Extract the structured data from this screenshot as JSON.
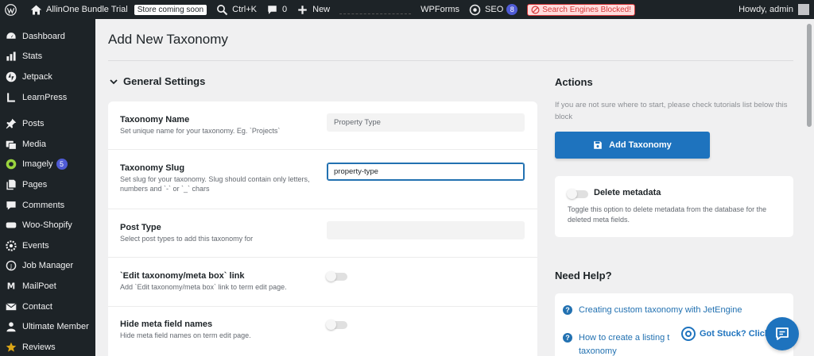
{
  "adminbar": {
    "site_name": "AllinOne Bundle Trial",
    "store_badge": "Store coming soon",
    "search_shortcut": "Ctrl+K",
    "comments_count": "0",
    "new_label": "New",
    "wpforms_label": "WPForms",
    "seo_label": "SEO",
    "seo_count": "8",
    "blocked_label": "Search Engines Blocked!",
    "howdy": "Howdy, admin"
  },
  "sidebar": {
    "items": [
      {
        "label": "Dashboard"
      },
      {
        "label": "Stats"
      },
      {
        "label": "Jetpack"
      },
      {
        "label": "LearnPress"
      },
      {
        "label": "Posts"
      },
      {
        "label": "Media"
      },
      {
        "label": "Imagely",
        "count": "5"
      },
      {
        "label": "Pages"
      },
      {
        "label": "Comments"
      },
      {
        "label": "Woo-Shopify"
      },
      {
        "label": "Events"
      },
      {
        "label": "Job Manager"
      },
      {
        "label": "MailPoet"
      },
      {
        "label": "Contact"
      },
      {
        "label": "Ultimate Member"
      },
      {
        "label": "Reviews"
      }
    ]
  },
  "page": {
    "title": "Add New Taxonomy",
    "section_title": "General Settings"
  },
  "settings": {
    "taxonomy_name": {
      "label": "Taxonomy Name",
      "desc": "Set unique name for your taxonomy. Eg. `Projects`",
      "value": "Property Type"
    },
    "taxonomy_slug": {
      "label": "Taxonomy Slug",
      "desc": "Set slug for your taxonomy. Slug should contain only letters, numbers and `-` or `_` chars",
      "value": "property-type"
    },
    "post_type": {
      "label": "Post Type",
      "desc": "Select post types to add this taxonomy for"
    },
    "edit_link": {
      "label": "`Edit taxonomy/meta box` link",
      "desc": "Add `Edit taxonomy/meta box` link to term edit page."
    },
    "hide_meta": {
      "label": "Hide meta field names",
      "desc": "Hide meta field names on term edit page."
    }
  },
  "actions": {
    "title": "Actions",
    "hint": "If you are not sure where to start, please check tutorials list below this block",
    "add_button": "Add Taxonomy",
    "delete_meta_label": "Delete metadata",
    "delete_meta_desc": "Toggle this option to delete metadata from the database for the deleted meta fields."
  },
  "help": {
    "title": "Need Help?",
    "links": [
      {
        "label": "Creating custom taxonomy with JetEngine"
      },
      {
        "label": "How to create a listing t",
        "label_line2": "taxonomy"
      }
    ],
    "got_stuck": "Got Stuck? Click"
  },
  "colors": {
    "primary": "#1e73be",
    "admin_dark": "#1d2327",
    "badge": "#4f5bd5",
    "blocked": "#d63638"
  }
}
